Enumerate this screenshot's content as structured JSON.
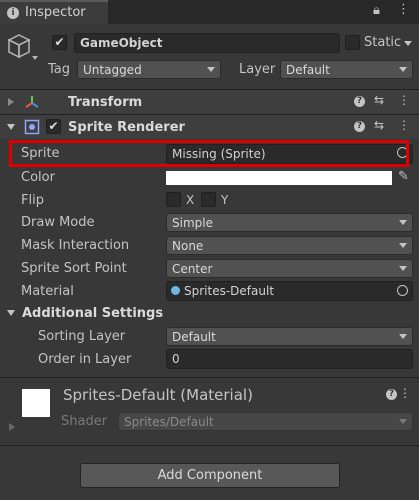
{
  "tab": {
    "title": "Inspector"
  },
  "gameobject": {
    "name": "GameObject",
    "static_label": "Static",
    "tag_label": "Tag",
    "tag_value": "Untagged",
    "layer_label": "Layer",
    "layer_value": "Default"
  },
  "components": {
    "transform": {
      "title": "Transform"
    },
    "sprite_renderer": {
      "title": "Sprite Renderer"
    }
  },
  "props": {
    "sprite": {
      "label": "Sprite",
      "value": "Missing (Sprite)"
    },
    "color": {
      "label": "Color",
      "value": "#ffffff"
    },
    "flip": {
      "label": "Flip",
      "x": "X",
      "y": "Y"
    },
    "draw_mode": {
      "label": "Draw Mode",
      "value": "Simple"
    },
    "mask_interaction": {
      "label": "Mask Interaction",
      "value": "None"
    },
    "sprite_sort_point": {
      "label": "Sprite Sort Point",
      "value": "Center"
    },
    "material": {
      "label": "Material",
      "value": "Sprites-Default"
    }
  },
  "additional": {
    "title": "Additional Settings",
    "sorting_layer": {
      "label": "Sorting Layer",
      "value": "Default"
    },
    "order_in_layer": {
      "label": "Order in Layer",
      "value": "0"
    }
  },
  "material_section": {
    "title": "Sprites-Default (Material)",
    "shader_label": "Shader",
    "shader_value": "Sprites/Default"
  },
  "add_component": {
    "label": "Add Component"
  },
  "colors": {
    "highlight": "#e00000",
    "background": "#383838"
  }
}
